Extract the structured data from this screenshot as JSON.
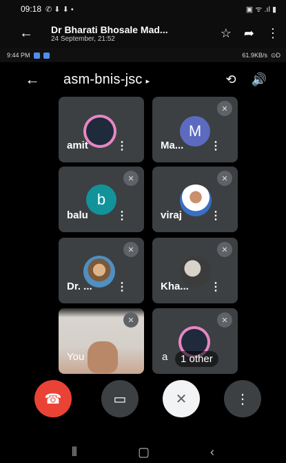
{
  "outer_status": {
    "time": "09:18",
    "icons_left": "✆ ⬇ ⬇ •",
    "icons_right": "▣ ᯤ .ıl ▮"
  },
  "viewer_bar": {
    "title": "Dr Bharati Bhosale Mad...",
    "subtitle": "24 September, 21:52"
  },
  "inner_status": {
    "time": "9:44 PM",
    "speed": "61.9KB/s",
    "right": "⊙D"
  },
  "meeting": {
    "code": "asm-bnis-jsc"
  },
  "participants": [
    {
      "name": "amit",
      "initial": "",
      "avatar_type": "ring",
      "muted": false
    },
    {
      "name": "Ma...",
      "initial": "M",
      "avatar_color": "#5c6bc0",
      "avatar_type": "letter",
      "muted": true
    },
    {
      "name": "balu",
      "initial": "b",
      "avatar_color": "#12939a",
      "avatar_type": "letter",
      "muted": true
    },
    {
      "name": "viraj",
      "initial": "",
      "avatar_type": "photo",
      "muted": true
    },
    {
      "name": "Dr. ...",
      "initial": "",
      "avatar_type": "photo",
      "muted": true
    },
    {
      "name": "Kha...",
      "initial": "",
      "avatar_type": "photo",
      "muted": true
    }
  ],
  "self_tile": {
    "label": "You"
  },
  "others_tile": {
    "label": "1 other",
    "partial": "a"
  },
  "more_glyph": "⋮",
  "muted_glyph": "🎙̸",
  "icons": {
    "back": "←",
    "share": "➦",
    "star": "☆",
    "switch_camera": "⟲",
    "speaker": "🔊",
    "end_call": "☎",
    "camera": "▭",
    "mic_off": "✕",
    "nav_recents": "⦀",
    "nav_home": "▢",
    "nav_back": "‹"
  },
  "colors": {
    "end_call": "#ea4335",
    "tile_bg": "#3c4043",
    "ring": "#e786c4"
  }
}
